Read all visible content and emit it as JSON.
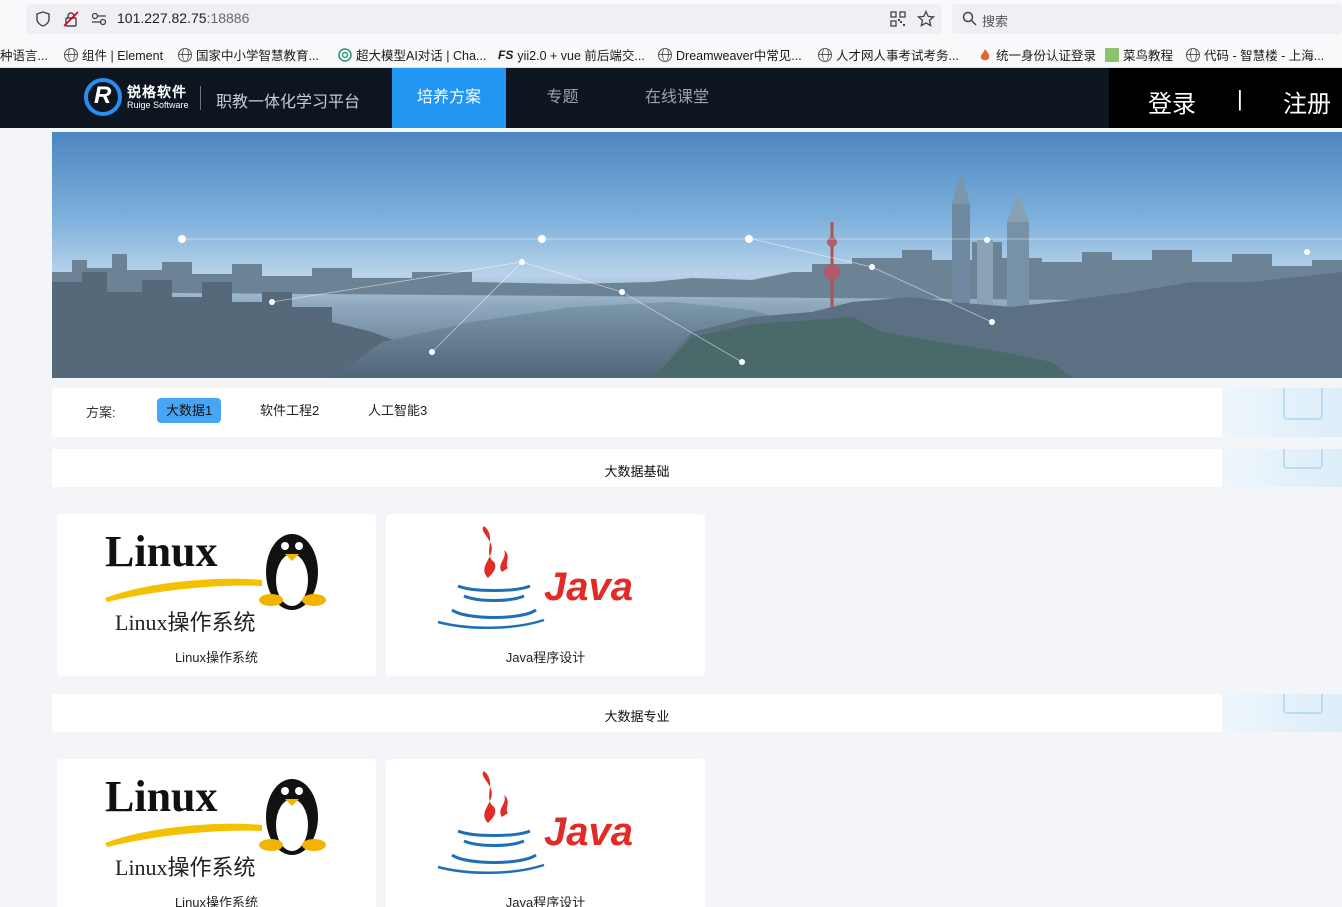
{
  "browser": {
    "url_host": "101.227.82.75",
    "url_port": ":18886",
    "search_placeholder": "搜索",
    "bookmarks": [
      "种语言...",
      "组件 | Element",
      "国家中小学智慧教育...",
      "超大模型AI对话 | Cha...",
      "yii2.0 + vue 前后端交...",
      "Dreamweaver中常见...",
      "人才网人事考试考务...",
      "统一身份认证登录",
      "菜鸟教程",
      "代码 - 智慧楼 - 上海..."
    ]
  },
  "site": {
    "logo_cn": "锐格软件",
    "logo_en": "Ruige Software",
    "platform_name": "职教一体化学习平台",
    "nav": [
      "培养方案",
      "专题",
      "在线课堂"
    ],
    "login": "登录",
    "separator": "|",
    "register": "注册"
  },
  "scheme": {
    "label": "方案:",
    "tabs": [
      "大数据1",
      "软件工程2",
      "人工智能3"
    ],
    "active_tab": "大数据1"
  },
  "sections": [
    {
      "title": "大数据基础",
      "courses": [
        {
          "name": "Linux操作系统",
          "logo_wordmark": "Linux",
          "logo_subtitle": "Linux操作系统"
        },
        {
          "name": "Java程序设计",
          "logo_wordmark": "Java"
        }
      ]
    },
    {
      "title": "大数据专业",
      "courses": [
        {
          "name": "Linux操作系统",
          "logo_wordmark": "Linux",
          "logo_subtitle": "Linux操作系统"
        },
        {
          "name": "Java程序设计",
          "logo_wordmark": "Java"
        }
      ]
    }
  ],
  "colors": {
    "nav_bg": "#0d1620",
    "nav_active": "#2196f3",
    "tab_active": "#46a6f5",
    "java_red": "#e22a26",
    "java_blue": "#1f6fb8"
  }
}
